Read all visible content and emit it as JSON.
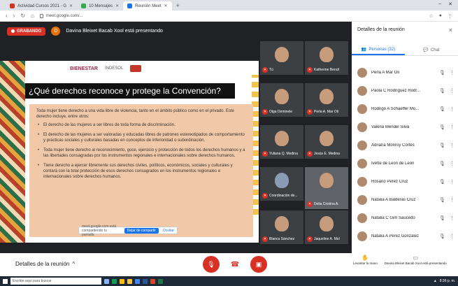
{
  "browser": {
    "tabs": [
      {
        "label": "Actividad Cursos 2021 - G",
        "color": "#d93025",
        "active": false
      },
      {
        "label": "10 Mensajes",
        "color": "#34a853",
        "active": false
      },
      {
        "label": "Reunión Meet",
        "color": "#1a73e8",
        "active": true
      }
    ],
    "new_tab": "+",
    "url": "meet.google.com/..."
  },
  "meet": {
    "recording_label": "GRABANDO",
    "presenter_initial": "D",
    "presenter_text": "Davina Bleixet Bacab Xool está presentando",
    "slide": {
      "logo_main": "BIENESTAR",
      "logo_secondary": "INDESOL",
      "title": "¿Qué derechos reconoce y protege la Convención?",
      "intro": "Toda mujer tiene derecho a una vida libre de violencia, tanto en el ámbito público como en el privado. Este derecho incluye, entre otros:",
      "bullets": [
        "El derecho de las mujeres a ser libres de toda forma de discriminación.",
        "El derecho de las mujeres a ser valoradas y educadas libres de patrones estereotipados de comportamiento y prácticas sociales y culturales basadas en conceptos de inferioridad o subordinación.",
        "Toda mujer tiene derecho al reconocimiento, goce, ejercicio y protección de todos los derechos humanos y a las libertades consagradas por los instrumentos regionales e internacionales sobre derechos humanos.",
        "Tiene derecho a ejercer libremente sus derechos civiles, políticos, económicos, sociales y culturales y contará con la total protección de esos derechos consagrados en los instrumentos regionales e internacionales sobre derechos humanos."
      ],
      "share_text": "meet.google.com está compartiendo tu pantalla",
      "share_stop": "Dejar de compartir",
      "share_hide": "Ocultar"
    },
    "tiles": [
      {
        "label": "Tú"
      },
      {
        "label": "Katherine Bencil"
      },
      {
        "label": "Olga Dominele"
      },
      {
        "label": "Perla A. Mar Oli"
      },
      {
        "label": "Yuliana Q. Medina"
      },
      {
        "label": "Jesús E. Medina"
      },
      {
        "label": "Coordinación de..."
      },
      {
        "label": "Delia Cristina A."
      },
      {
        "label": "Blanca Sánchez"
      },
      {
        "label": "Jaqueline A. Mol"
      }
    ]
  },
  "panel": {
    "title": "Detalles de la reunión",
    "close": "×",
    "tab_people": "Personas (32)",
    "tab_chat": "Chat",
    "people": [
      {
        "name": "Perla A Mar Oli"
      },
      {
        "name": "Paola C Rodríguez Rodr..."
      },
      {
        "name": "Rodrigo A Schaeffer Mo..."
      },
      {
        "name": "Valeria Mendel Silva"
      },
      {
        "name": "Adriana Monroy Cortés"
      },
      {
        "name": "Ivette de Leon de Leon"
      },
      {
        "name": "Rosario Pérez Cruz"
      },
      {
        "name": "Natalia A Balderas Cruz"
      },
      {
        "name": "Natalia C Gim Saucedo"
      },
      {
        "name": "Natalia A Pérez González"
      }
    ]
  },
  "bottom": {
    "meeting_details": "Detalles de la reunión",
    "chevron": "^",
    "raise_hand": "Levantar la mano",
    "presenting": "Davina Bleixet Bacab Xool está presentando"
  },
  "taskbar": {
    "search_placeholder": "Escribe aquí para buscar",
    "time": "8:36 p. m."
  }
}
